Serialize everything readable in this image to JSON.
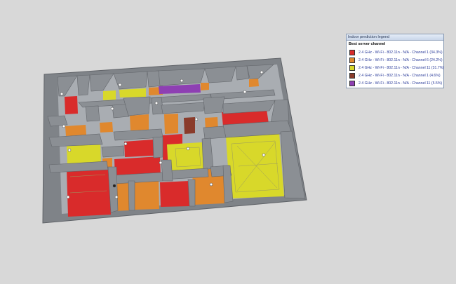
{
  "legend": {
    "title": "Indoor prediction legend",
    "subtitle": "Best server channel",
    "items": [
      {
        "label": "2.4 GHz - Wi-Fi - 802.11n - N/A - Channel  1 (34.3%)",
        "color": "#d92b2b"
      },
      {
        "label": "2.4 GHz - Wi-Fi - 802.11n - N/A - Channel  6 (24.2%)",
        "color": "#e0882e"
      },
      {
        "label": "2.4 GHz - Wi-Fi - 802.11n - N/A - Channel  11 (31.7%)",
        "color": "#d8d82a"
      },
      {
        "label": "2.4 GHz - Wi-Fi - 802.11n - N/A - Channel  1 (4.6%)",
        "color": "#8a3b2b"
      },
      {
        "label": "2.4 GHz - Wi-Fi - 802.11n - N/A - Channel  11 (5.5%)",
        "color": "#8e3fb3"
      }
    ]
  },
  "colors": {
    "background": "#d8d8d8",
    "wall_top": "#8d9095",
    "wall_side": "#6f7378",
    "floor": "#b9bdc2",
    "ch1": "#d92b2b",
    "ch6": "#e0882e",
    "ch11": "#d8d82a",
    "ch1b": "#8a3b2b",
    "ch11b": "#8e3fb3"
  },
  "map": {
    "access_point_icon": "ap-dot-icon"
  }
}
